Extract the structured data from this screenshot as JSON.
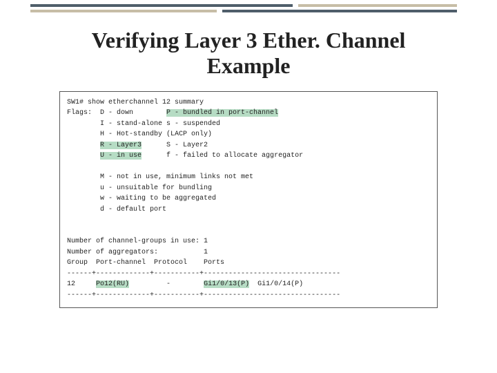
{
  "title_line1": "Verifying Layer 3 Ether. Channel",
  "title_line2": "Example",
  "cli": {
    "cmd_prefix": "SW1# ",
    "cmd": "show etherchannel 12 summary",
    "flags_label": "Flags:  D - down        ",
    "flag_P": "P - bundled in port-channel",
    "line_I": "        I - stand-alone s - suspended",
    "line_H": "        H - Hot-standby (LACP only)",
    "sp_R": "        ",
    "flag_R": "R - Layer3",
    "gap_RS": "      S - Layer2",
    "sp_U": "        ",
    "flag_U": "U - in use",
    "gap_Uf": "      f - failed to allocate aggregator",
    "line_M": "        M - not in use, minimum links not met",
    "line_u": "        u - unsuitable for bundling",
    "line_w": "        w - waiting to be aggregated",
    "line_d": "        d - default port",
    "summary1": "Number of channel-groups in use: 1",
    "summary2": "Number of aggregators:           1",
    "hdr": "Group  Port-channel  Protocol    Ports",
    "rule1": "------+-------------+-----------+---------------------------------",
    "row_grp": "12     ",
    "row_pc": "Po12(RU)",
    "row_proto": "         -        ",
    "row_p1": "Gi1/0/13(P)",
    "row_gap": "  Gi1/0/14(P)",
    "rule2": "------+-------------+-----------+---------------------------------"
  }
}
